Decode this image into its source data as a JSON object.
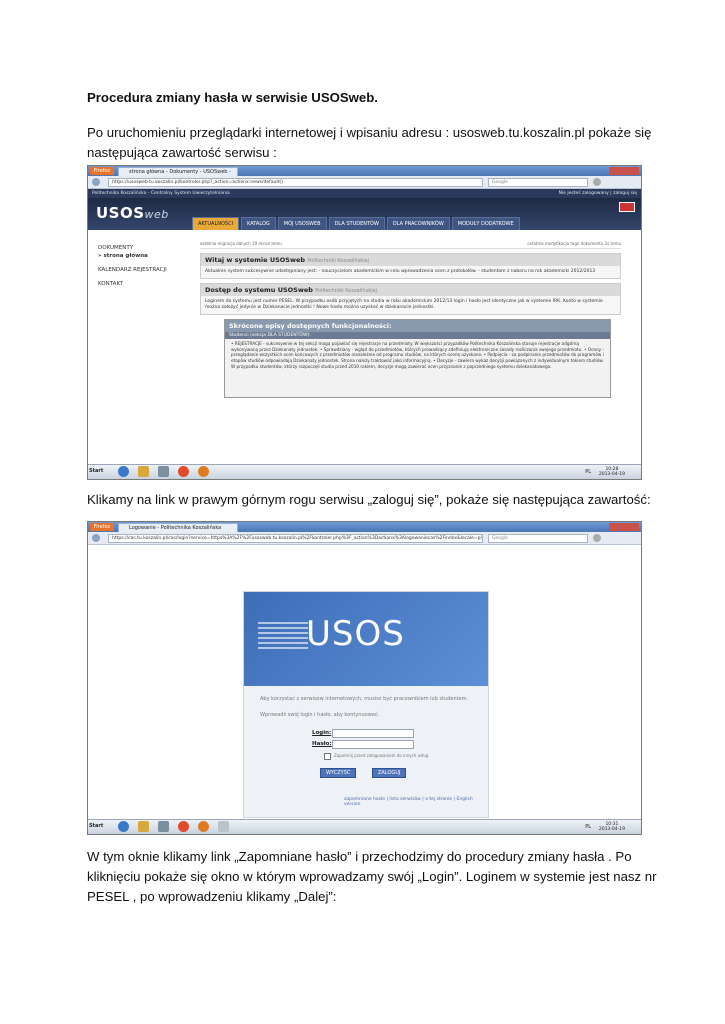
{
  "doc": {
    "title": "Procedura zmiany hasła w serwisie USOSweb.",
    "para1_line1": "Po uruchomieniu przeglądarki internetowej i wpisaniu adresu :  usosweb.tu.koszalin.pl  pokaże się",
    "para1_line2": "następująca zawartość serwisu :",
    "para2": "Klikamy na link w prawym górnym rogu serwisu „zaloguj się”, pokaże się następująca zawartość:",
    "para3_line1": "W tym oknie klikamy link „Zapomniane hasło” i przechodzimy do procedury zmiany hasła . Po",
    "para3_line2": "kliknięciu pokaże się okno w którym wprowadzamy swój „Login”. Loginem w systemie jest nasz nr",
    "para3_line3": "PESEL , po wprowadzeniu klikamy „Dalej”:"
  },
  "shot1": {
    "ff_label": "Firefox",
    "tab_title": "strona główna - Dokumenty - USOSweb - Pol...",
    "url": "https://usosweb.tu.koszalin.pl/kontroler.php?_action=actionx:news/default()",
    "search_placeholder": "Google",
    "site_topbar": "Politechnika Koszalińska - Centralny System Uwierzytelniania",
    "site_topbar_right": "Nie jesteś zalogowany | zaloguj się",
    "logo": "USOS",
    "logo_suffix": "web",
    "menu": [
      "AKTUALNOŚCI",
      "KATALOG",
      "MÓJ USOSWEB",
      "DLA STUDENTÓW",
      "DLA PRACOWNIKÓW",
      "MODUŁY DODATKOWE"
    ],
    "sidebar": [
      "DOKUMENTY",
      "» strona główna",
      "KALENDARZ REJESTRACJI",
      "KONTAKT"
    ],
    "crumb_left": "ostatnia migracja danych 19 minut temu",
    "crumb_right": "ostatnia modyfikacja tego dokumentu 2s temu",
    "box1_title": "Witaj w systemie USOSweb",
    "box1_sub": "Politechniki Koszalińskiej",
    "box1_body": "Aktualnie system sukcesywnie udostępniany jest: - nauczycielom akademickim w celu wprowadzenia ocen z protokołów. - studentom z naboru na rok akademicki 2012/2013",
    "box2_title": "Dostęp do systemu USOSweb",
    "box2_sub": "Politechniki Koszalińskiej",
    "box2_body": "Loginem do systemu jest numer PESEL. W przypadku osób przyjętych na studia w roku akademickim 2012/13 login i hasło jest identyczne jak w systemie IRK. Konto w systemie można założyć jedynie w Dziekanacie jednostki ! Nowe hasło można uzyskać w dziekanacie jednostki.",
    "func_title": "Skrócone opisy dostępnych funkcjonalności:",
    "func_sub": "Studenci (sekcja DLA STUDENTÓW):",
    "func_body": "• REJESTRACJE - sukcesywnie w tej sekcji mogą pojawiać się rejestracje na przedmioty. W większości przypadków Politechnika Koszalińska stosuje rejestracje odgórną wykonywaną przez Dziekanaty jednostek. • Sprawdziany - wgląd do przedmiotów, których prowadzący zdefiniują elektroniczne zasady rozliczania swojego przedmiotu. • Oceny - przeglądanie wszystkich ocen końcowych z przedmiotów niezależnie od programu studiów, na których ocenę uzyskano. • Podpięcia - za podpinanie przedmiotów do programów i etapów studiów odpowiadają Dziekanaty jednostek. Strona należy traktować jako informacyjną. • Decyzje - zawiera wykaz decyzji powiązanych z indywidualnym tokiem studiów. W przypadku studentów, którzy rozpoczęli studia przed 2010 rokiem, decyzje mogą zawierać ocen przyznanie z poprzedniego systemu dziekanatowego.",
    "start": "Start",
    "lang": "PL",
    "time": "10:28",
    "date": "2013-04-19"
  },
  "shot2": {
    "ff_label": "Firefox",
    "tab_title": "Logowanie - Politechnika Koszalińska",
    "url": "https://cas.tu.koszalin.pl/cas/login?service=https%3A%2F%2Fusosweb.tu.koszalin.pl%2Fkontroler.php%3F_action%3Dactionx%3Alogowaniecas%2Findex&locale=pl",
    "search_placeholder": "Google",
    "logo": "USOS",
    "info1": "Aby korzystać z serwisów internetowych, musisz być pracownikiem lub studentem.",
    "info2": "Wprowadź swój login i hasło, aby kontynuować.",
    "login_label": "Login:",
    "password_label": "Hasło:",
    "remember": "Zapomnij przed zalogowaniem do innych usług",
    "btn_clear": "WYCZYŚĆ",
    "btn_login": "ZALOGUJ",
    "links": "zapomniane hasło | lista serwisów | o tej stronie | English version",
    "start": "Start",
    "lang": "PL",
    "time": "10:31",
    "date": "2013-04-19"
  }
}
